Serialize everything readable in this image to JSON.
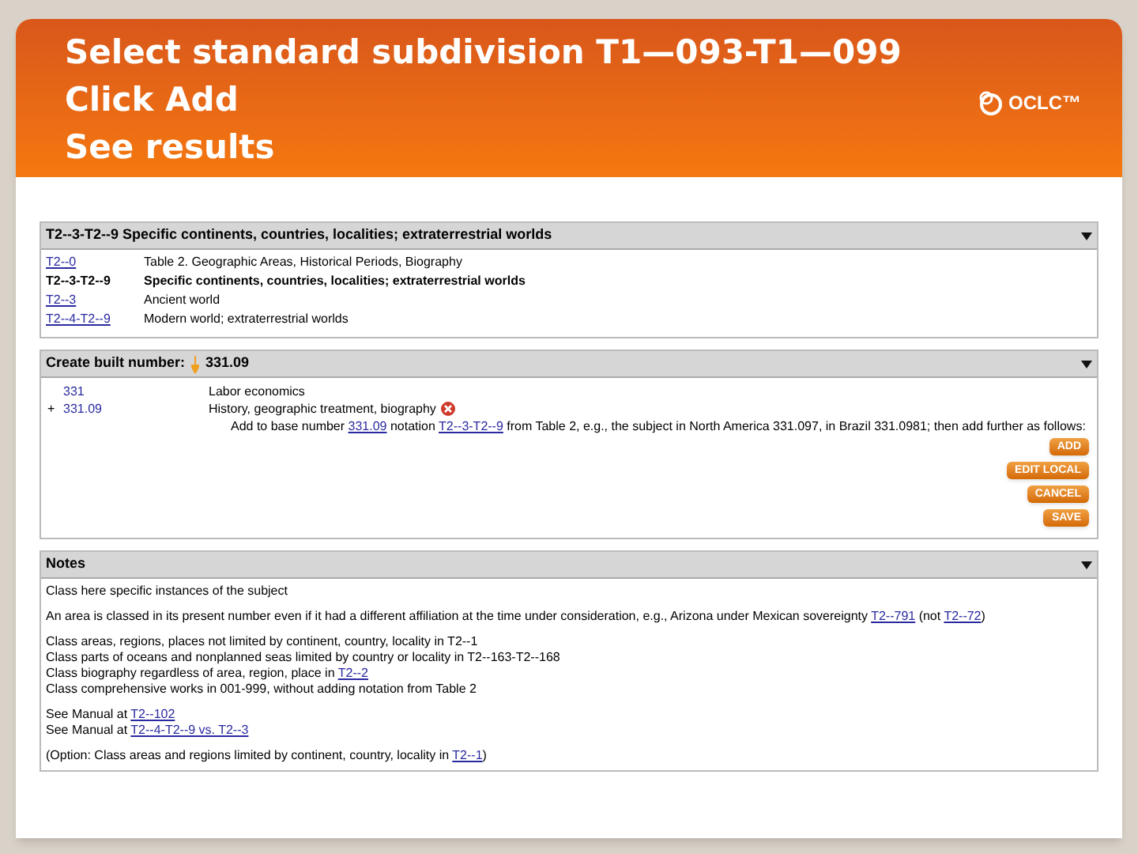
{
  "slide": {
    "title_lines": [
      "Select standard subdivision T1—093-T1—099",
      "Click Add",
      "See results"
    ],
    "logo": "OCLC™"
  },
  "hierarchy_panel": {
    "title": "T2--3-T2--9 Specific continents, countries, localities; extraterrestrial worlds",
    "rows": [
      {
        "number": "T2--0",
        "kind": "link",
        "caption": "Table 2. Geographic Areas, Historical Periods, Biography"
      },
      {
        "number": "T2--3-T2--9",
        "kind": "current",
        "caption": "Specific continents, countries, localities; extraterrestrial worlds"
      },
      {
        "number": "T2--3",
        "kind": "link",
        "caption": "Ancient world"
      },
      {
        "number": "T2--4-T2--9",
        "kind": "link",
        "caption": "Modern world; extraterrestrial worlds"
      }
    ]
  },
  "build_panel": {
    "title": "Create built number:",
    "built_number": "331.09",
    "rows": [
      {
        "marker": "",
        "number": "331",
        "caption": "Labor economics",
        "removable": false
      },
      {
        "marker": "+",
        "number": "331.09",
        "caption": "History, geographic treatment, biography",
        "removable": true
      }
    ],
    "instruction": [
      {
        "kind": "text",
        "text": "Add to base number "
      },
      {
        "kind": "link",
        "text": "331.09"
      },
      {
        "kind": "text",
        "text": " notation "
      },
      {
        "kind": "link",
        "text": "T2--3-T2--9"
      },
      {
        "kind": "text",
        "text": " from Table 2, e.g., the subject in North America 331.097, in Brazil 331.0981; then add further as follows:"
      }
    ],
    "buttons": [
      "ADD",
      "EDIT LOCAL",
      "CANCEL",
      "SAVE"
    ]
  },
  "notes_panel": {
    "title": "Notes",
    "groups": [
      [
        [
          {
            "kind": "text",
            "text": "Class here specific instances of the subject"
          }
        ]
      ],
      [
        [
          {
            "kind": "text",
            "text": "An area is classed in its present number even if it had a different affiliation at the time under consideration, e.g., Arizona under Mexican sovereignty "
          },
          {
            "kind": "link",
            "text": "T2--791"
          },
          {
            "kind": "text",
            "text": " (not "
          },
          {
            "kind": "link",
            "text": "T2--72"
          },
          {
            "kind": "text",
            "text": ")"
          }
        ]
      ],
      [
        [
          {
            "kind": "text",
            "text": "Class areas, regions, places not limited by continent, country, locality in T2--1"
          }
        ],
        [
          {
            "kind": "text",
            "text": "Class parts of oceans and nonplanned seas limited by country or locality in T2--163-T2--168"
          }
        ],
        [
          {
            "kind": "text",
            "text": "Class biography regardless of area, region, place in "
          },
          {
            "kind": "link",
            "text": "T2--2"
          }
        ],
        [
          {
            "kind": "text",
            "text": "Class comprehensive works in 001-999, without adding notation from Table 2"
          }
        ]
      ],
      [
        [
          {
            "kind": "text",
            "text": "See Manual at "
          },
          {
            "kind": "link",
            "text": "T2--102"
          }
        ],
        [
          {
            "kind": "text",
            "text": "See Manual at "
          },
          {
            "kind": "link",
            "text": "T2--4-T2--9 vs. T2--3"
          }
        ]
      ],
      [
        [
          {
            "kind": "text",
            "text": "(Option: Class areas and regions limited by continent, country, locality in "
          },
          {
            "kind": "link",
            "text": "T2--1"
          },
          {
            "kind": "text",
            "text": ")"
          }
        ]
      ]
    ]
  }
}
